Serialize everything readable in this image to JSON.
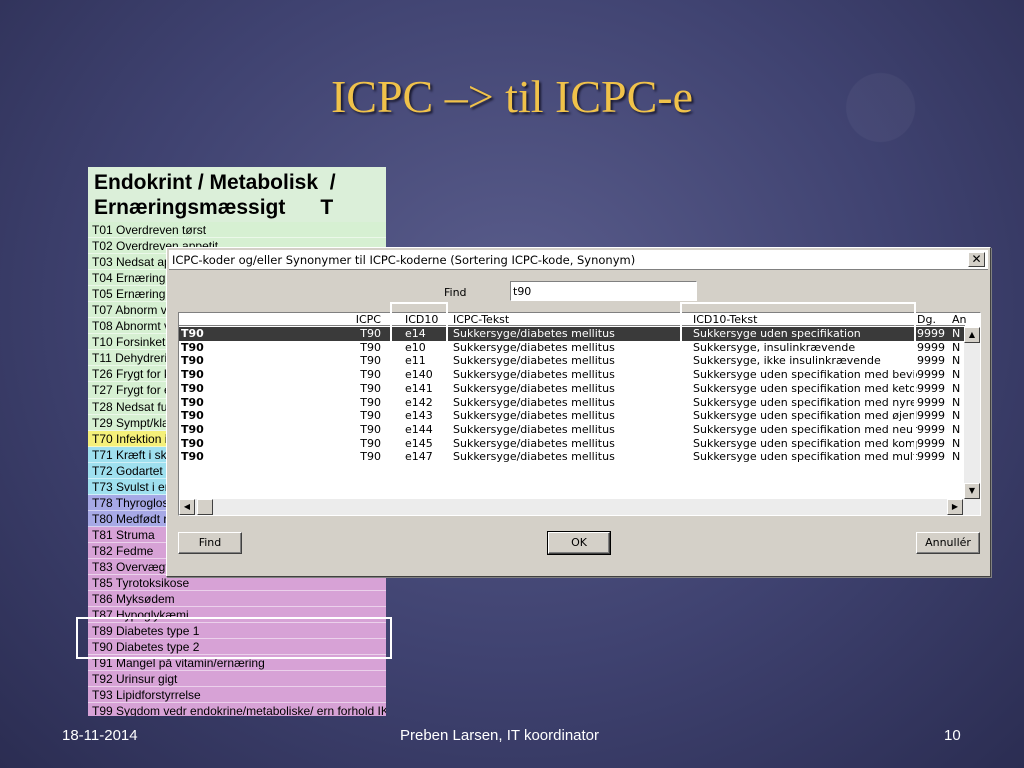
{
  "slide": {
    "title": "ICPC –> til ICPC-e",
    "footer_date": "18-11-2014",
    "footer_author": "Preben Larsen, IT koordinator",
    "footer_page": "10"
  },
  "list_panel": {
    "heading": "Endokrint / Metabolisk  /\nErnæringsmæssigt      T",
    "items": [
      {
        "label": "T01  Overdreven tørst",
        "color": "green"
      },
      {
        "label": "T02  Overdreven appetit",
        "color": "green"
      },
      {
        "label": "T03  Nedsat ap",
        "color": "green"
      },
      {
        "label": "T04  Ernæring",
        "color": "green"
      },
      {
        "label": "T05  Ernæring",
        "color": "green"
      },
      {
        "label": "T07  Abnorm v",
        "color": "green"
      },
      {
        "label": "T08  Abnormt v",
        "color": "green"
      },
      {
        "label": "T10  Forsinket",
        "color": "green"
      },
      {
        "label": "T11  Dehydreri",
        "color": "green"
      },
      {
        "label": "T26  Frygt for k",
        "color": "green"
      },
      {
        "label": "T27  Frygt for e",
        "color": "green"
      },
      {
        "label": "T28  Nedsat fu",
        "color": "green"
      },
      {
        "label": "T29  Sympt/kla",
        "color": "green"
      },
      {
        "label": "T70  Infektion i",
        "color": "yellow"
      },
      {
        "label": "T71  Kræft i sk",
        "color": "cyan"
      },
      {
        "label": "T72  Godartet s",
        "color": "cyan"
      },
      {
        "label": "T73  Svulst i er",
        "color": "cyan"
      },
      {
        "label": "T78  Thyroglos",
        "color": "blue"
      },
      {
        "label": "T80  Medfødt r",
        "color": "blue"
      },
      {
        "label": "T81  Struma",
        "color": "pink"
      },
      {
        "label": "T82  Fedme",
        "color": "pink"
      },
      {
        "label": "T83  Overvægt",
        "color": "pink"
      },
      {
        "label": "T85  Tyrotoksikose",
        "color": "pink"
      },
      {
        "label": "T86  Myksødem",
        "color": "pink"
      },
      {
        "label": "T87  Hypoglykæmi",
        "color": "pink"
      },
      {
        "label": "T89  Diabetes type 1",
        "color": "pink"
      },
      {
        "label": "T90  Diabetes type 2",
        "color": "pink"
      },
      {
        "label": "T91  Mangel på vitamin/ernæring",
        "color": "pink"
      },
      {
        "label": "T92  Urinsur gigt",
        "color": "pink"
      },
      {
        "label": "T93  Lipidforstyrrelse",
        "color": "pink"
      },
      {
        "label": "T99  Sygdom vedr endokrine/metaboliske/ ern forhold IKA",
        "color": "pink"
      }
    ]
  },
  "dialog": {
    "title": "ICPC-koder og/eller Synonymer til ICPC-koderne (Sortering ICPC-kode, Synonym)",
    "close_label": "✕",
    "find_label": "Find",
    "find_value": "t90",
    "columns": [
      "",
      "ICPC",
      "ICD10",
      "ICPC-Tekst",
      "ICD10-Tekst",
      "Dg.",
      "An"
    ],
    "rows": [
      [
        "T90",
        "T90",
        "e14",
        "Sukkersyge/diabetes mellitus",
        "Sukkersyge uden specifikation",
        "9999",
        "N"
      ],
      [
        "T90",
        "T90",
        "e10",
        "Sukkersyge/diabetes mellitus",
        "Sukkersyge, insulinkrævende",
        "9999",
        "N"
      ],
      [
        "T90",
        "T90",
        "e11",
        "Sukkersyge/diabetes mellitus",
        "Sukkersyge, ikke insulinkrævende",
        "9999",
        "N"
      ],
      [
        "T90",
        "T90",
        "e140",
        "Sukkersyge/diabetes mellitus",
        "Sukkersyge uden specifikation med bevid",
        "9999",
        "N"
      ],
      [
        "T90",
        "T90",
        "e141",
        "Sukkersyge/diabetes mellitus",
        "Sukkersyge uden specifikation med ketos",
        "9999",
        "N"
      ],
      [
        "T90",
        "T90",
        "e142",
        "Sukkersyge/diabetes mellitus",
        "Sukkersyge uden specifikation med nyrek",
        "9999",
        "N"
      ],
      [
        "T90",
        "T90",
        "e143",
        "Sukkersyge/diabetes mellitus",
        "Sukkersyge uden specifikation med øjenk",
        "9999",
        "N"
      ],
      [
        "T90",
        "T90",
        "e144",
        "Sukkersyge/diabetes mellitus",
        "Sukkersyge uden specifikation med neuro",
        "9999",
        "N"
      ],
      [
        "T90",
        "T90",
        "e145",
        "Sukkersyge/diabetes mellitus",
        "Sukkersyge uden specifikation med komp",
        "9999",
        "N"
      ],
      [
        "T90",
        "T90",
        "e147",
        "Sukkersyge/diabetes mellitus",
        "Sukkersyge uden specifikation med multi",
        "9999",
        "N"
      ]
    ],
    "selected_row": 0,
    "buttons": {
      "find": "Find",
      "ok": "OK",
      "cancel": "Annullér"
    }
  },
  "colors": {
    "title": "#f0c24a",
    "highlight_border": "#ffffff",
    "selection_bg": "#3a3a3a"
  }
}
